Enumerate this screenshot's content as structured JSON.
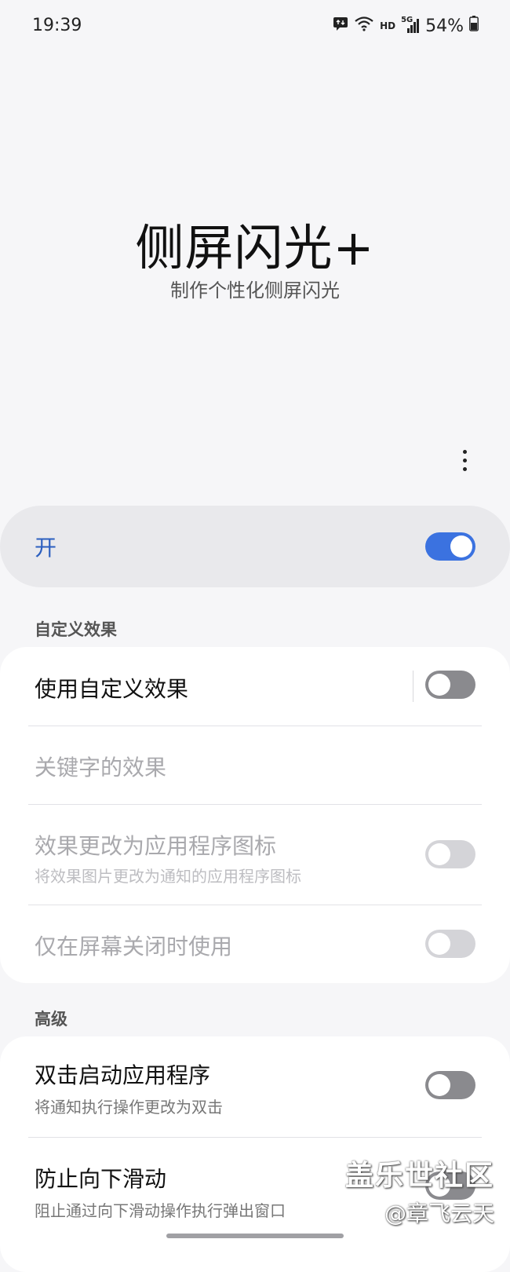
{
  "status": {
    "time": "19:39",
    "hd": "HD",
    "network": "5G",
    "battery": "54%",
    "icons": [
      "message-icon",
      "wifi-icon",
      "signal-icon",
      "battery-icon"
    ]
  },
  "hero": {
    "title": "侧屏闪光+",
    "subtitle": "制作个性化侧屏闪光"
  },
  "master_switch": {
    "label": "开",
    "state": true,
    "accent": "#3b72e0"
  },
  "sections": {
    "custom": {
      "header": "自定义效果",
      "rows": [
        {
          "title": "使用自定义效果",
          "toggle": false
        },
        {
          "title": "关键字的效果"
        },
        {
          "title": "效果更改为应用程序图标",
          "subtitle": "将效果图片更改为通知的应用程序图标",
          "toggle": false
        },
        {
          "title": "仅在屏幕关闭时使用",
          "toggle": false
        }
      ]
    },
    "advanced": {
      "header": "高级",
      "rows": [
        {
          "title": "双击启动应用程序",
          "subtitle": "将通知执行操作更改为双击",
          "toggle": false
        },
        {
          "title": "防止向下滑动",
          "subtitle": "阻止通过向下滑动操作执行弹出窗口",
          "toggle": false
        }
      ]
    }
  },
  "watermark": {
    "line1": "盖乐世社区",
    "line2": "@章飞云天"
  }
}
